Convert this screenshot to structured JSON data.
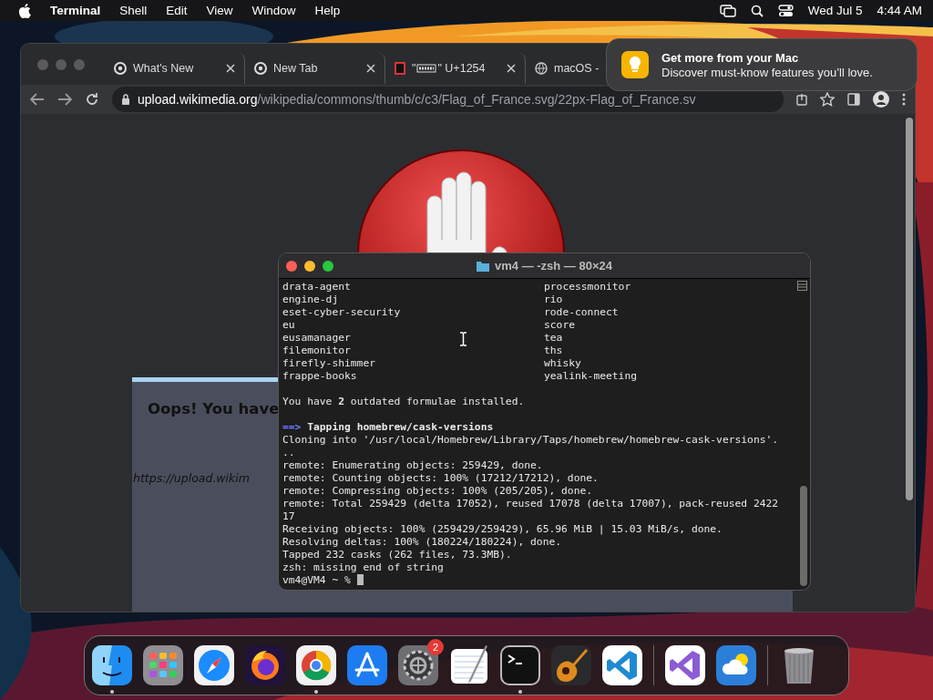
{
  "menu_bar": {
    "app_name": "Terminal",
    "menus": [
      "Shell",
      "Edit",
      "View",
      "Window",
      "Help"
    ],
    "date": "Wed Jul 5",
    "time": "4:44 AM"
  },
  "browser": {
    "tabs": [
      {
        "label": "What's New",
        "selected": false
      },
      {
        "label": "New Tab",
        "selected": false
      },
      {
        "label_start": "\"",
        "label_end": "\" U+1254",
        "selected": false
      },
      {
        "label": "macOS -",
        "selected": false
      }
    ],
    "address": {
      "host": "upload.wikimedia.org",
      "path": "/wikipedia/commons/thumb/c/c3/Flag_of_France.svg/22px-Flag_of_France.sv"
    },
    "page": {
      "heading": "Oops! You have",
      "link": "https://upload.wikim"
    }
  },
  "notification": {
    "title": "Get more from your Mac",
    "body": "Discover must-know features you’ll love."
  },
  "terminal": {
    "title": "vm4 — -zsh — 80×24",
    "columns": [
      [
        "drata-agent",
        "engine-dj",
        "eset-cyber-security",
        "eu",
        "eusamanager",
        "filemonitor",
        "firefly-shimmer",
        "frappe-books"
      ],
      [
        "processmonitor",
        "rio",
        "rode-connect",
        "score",
        "tea",
        "ths",
        "whisky",
        "yealink-meeting"
      ]
    ],
    "lines": [
      {
        "kind": "blank"
      },
      {
        "kind": "text",
        "text": "You have **2** outdated formulae installed."
      },
      {
        "kind": "blank"
      },
      {
        "kind": "heading",
        "arrow": "==>",
        "text": "Tapping homebrew/cask-versions"
      },
      {
        "kind": "text",
        "text": "Cloning into '/usr/local/Homebrew/Library/Taps/homebrew/homebrew-cask-versions'."
      },
      {
        "kind": "text",
        "text": ".."
      },
      {
        "kind": "text",
        "text": "remote: Enumerating objects: 259429, done."
      },
      {
        "kind": "text",
        "text": "remote: Counting objects: 100% (17212/17212), done."
      },
      {
        "kind": "text",
        "text": "remote: Compressing objects: 100% (205/205), done."
      },
      {
        "kind": "text",
        "text": "remote: Total 259429 (delta 17052), reused 17078 (delta 17007), pack-reused 2422"
      },
      {
        "kind": "text",
        "text": "17"
      },
      {
        "kind": "text",
        "text": "Receiving objects: 100% (259429/259429), 65.96 MiB | 15.03 MiB/s, done."
      },
      {
        "kind": "text",
        "text": "Resolving deltas: 100% (180224/180224), done."
      },
      {
        "kind": "text",
        "text": "Tapped 232 casks (262 files, 73.3MB)."
      },
      {
        "kind": "text",
        "text": "zsh: missing end of string"
      },
      {
        "kind": "prompt",
        "text": "vm4@VM4 ~ %"
      }
    ]
  },
  "dock": {
    "groups": [
      [
        {
          "running": true
        },
        {
          "running": false
        },
        {
          "running": false
        },
        {
          "running": false
        },
        {
          "running": true
        },
        {
          "running": false
        },
        {
          "running": false,
          "badge": "2"
        },
        {
          "running": false
        },
        {
          "running": true
        },
        {
          "running": false
        },
        {
          "running": false
        }
      ],
      [
        {
          "running": false
        },
        {
          "running": false
        }
      ],
      [
        {
          "running": false
        }
      ]
    ]
  }
}
